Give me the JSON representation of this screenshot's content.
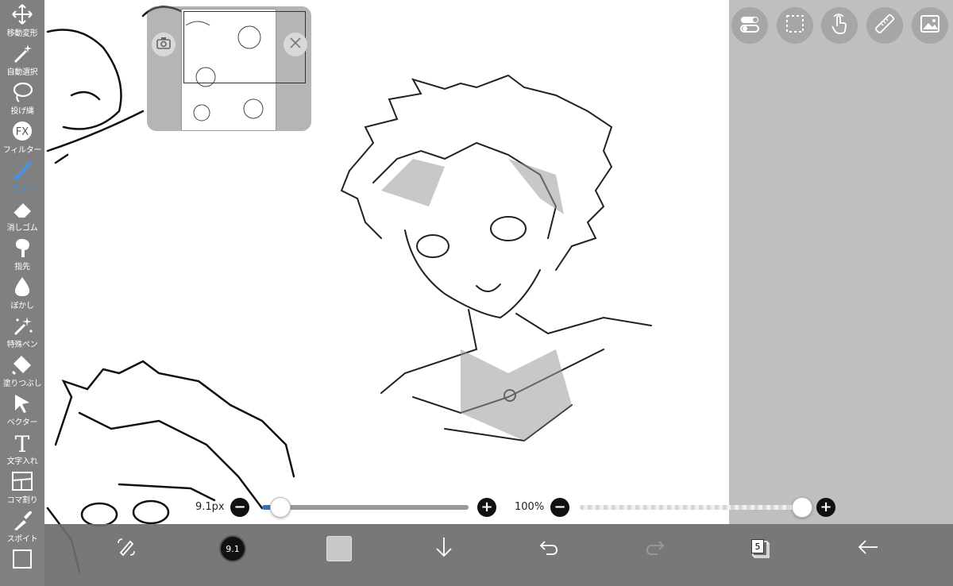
{
  "toolbar": {
    "items": [
      {
        "label": "移動変形",
        "icon": "move-icon"
      },
      {
        "label": "自動選択",
        "icon": "magic-wand-icon"
      },
      {
        "label": "投げ縄",
        "icon": "lasso-icon"
      },
      {
        "label": "フィルター",
        "icon": "fx-icon",
        "icon_text": "FX"
      },
      {
        "label": "ブラシ",
        "icon": "brush-icon",
        "active": true
      },
      {
        "label": "消しゴム",
        "icon": "eraser-icon"
      },
      {
        "label": "指先",
        "icon": "finger-icon"
      },
      {
        "label": "ぼかし",
        "icon": "blur-drop-icon"
      },
      {
        "label": "特殊ペン",
        "icon": "sparkle-pen-icon"
      },
      {
        "label": "塗りつぶし",
        "icon": "bucket-icon"
      },
      {
        "label": "ベクター",
        "icon": "vector-arrow-icon"
      },
      {
        "label": "文字入れ",
        "icon": "text-icon",
        "icon_text": "T"
      },
      {
        "label": "コマ割り",
        "icon": "frame-divider-icon"
      },
      {
        "label": "スポイト",
        "icon": "eyedropper-icon"
      },
      {
        "label": "",
        "icon": "canvas-icon"
      }
    ],
    "active_color": "#4a90e2"
  },
  "top_buttons": [
    "toggle-icon",
    "selection-icon",
    "gesture-hand-icon",
    "ruler-icon",
    "image-icon"
  ],
  "navigator": {
    "camera_icon": "camera-icon",
    "close_icon": "close-icon"
  },
  "brush_slider": {
    "value_label": "9.1px",
    "minus": "−",
    "plus": "+",
    "level": 0.02,
    "fill_color": "#3a6fb0"
  },
  "opacity_slider": {
    "value_label": "100%",
    "minus": "−",
    "plus": "+",
    "level": 1.0
  },
  "bottom_bar": {
    "brush_size_text": "9.1",
    "layer_count": "5",
    "color_swatch": "#c8c8c8",
    "icons": [
      "brush-swap-icon",
      "brush-size-icon",
      "color-swatch",
      "download-arrow-icon",
      "undo-icon",
      "redo-icon",
      "layers-icon",
      "back-arrow-icon"
    ]
  }
}
